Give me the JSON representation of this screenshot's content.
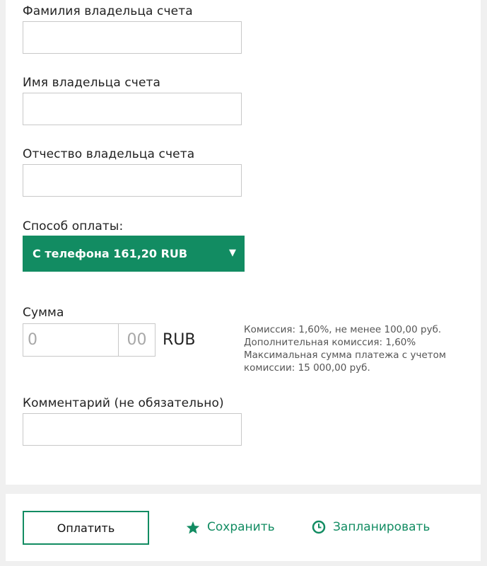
{
  "form": {
    "surname_label": "Фамилия владельца счета",
    "surname_value": "",
    "name_label": "Имя владельца счета",
    "name_value": "",
    "patronymic_label": "Отчество владельца счета",
    "patronymic_value": "",
    "payment_method_label": "Способ оплаты:",
    "payment_method_value": "С телефона 161,20 RUB",
    "amount_label": "Сумма",
    "amount_placeholder": "0",
    "cents_placeholder": "00",
    "currency": "RUB",
    "commission_info": [
      "Комиссия: 1,60%, не менее 100,00 руб.",
      "Дополнительная комиссия: 1,60%",
      "Максимальная сумма платежа с учетом",
      "комиссии: 15 000,00 руб."
    ],
    "comment_label": "Комментарий (не обязательно)",
    "comment_value": ""
  },
  "actions": {
    "pay_label": "Оплатить",
    "save_label": "Сохранить",
    "save_icon": "star-icon",
    "schedule_label": "Запланировать",
    "schedule_icon": "clock-icon"
  },
  "colors": {
    "accent": "#128c62",
    "background": "#f0f0f0",
    "field_border": "#c8c8c8"
  }
}
